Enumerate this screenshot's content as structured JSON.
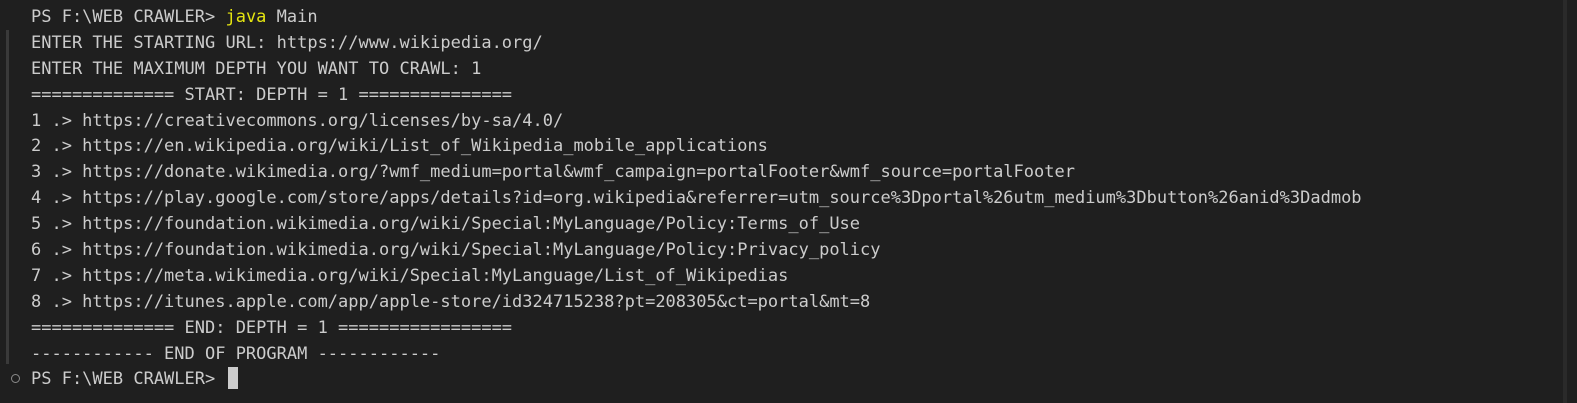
{
  "terminal": {
    "prompt_first": "PS F:\\WEB CRAWLER> ",
    "command": "java",
    "command_args": " Main",
    "output": [
      "ENTER THE STARTING URL: https://www.wikipedia.org/",
      "ENTER THE MAXIMUM DEPTH YOU WANT TO CRAWL: 1",
      "============== START: DEPTH = 1 ===============",
      "1 .> https://creativecommons.org/licenses/by-sa/4.0/",
      "2 .> https://en.wikipedia.org/wiki/List_of_Wikipedia_mobile_applications",
      "3 .> https://donate.wikimedia.org/?wmf_medium=portal&wmf_campaign=portalFooter&wmf_source=portalFooter",
      "4 .> https://play.google.com/store/apps/details?id=org.wikipedia&referrer=utm_source%3Dportal%26utm_medium%3Dbutton%26anid%3Dadmob",
      "5 .> https://foundation.wikimedia.org/wiki/Special:MyLanguage/Policy:Terms_of_Use",
      "6 .> https://foundation.wikimedia.org/wiki/Special:MyLanguage/Policy:Privacy_policy",
      "7 .> https://meta.wikimedia.org/wiki/Special:MyLanguage/List_of_Wikipedias",
      "8 .> https://itunes.apple.com/app/apple-store/id324715238?pt=208305&ct=portal&mt=8",
      "============== END: DEPTH = 1 =================",
      "------------ END OF PROGRAM ------------"
    ],
    "prompt_last": "PS F:\\WEB CRAWLER> "
  },
  "colors": {
    "background": "#1f1f1f",
    "text": "#cccccc",
    "command": "#e5e510"
  }
}
